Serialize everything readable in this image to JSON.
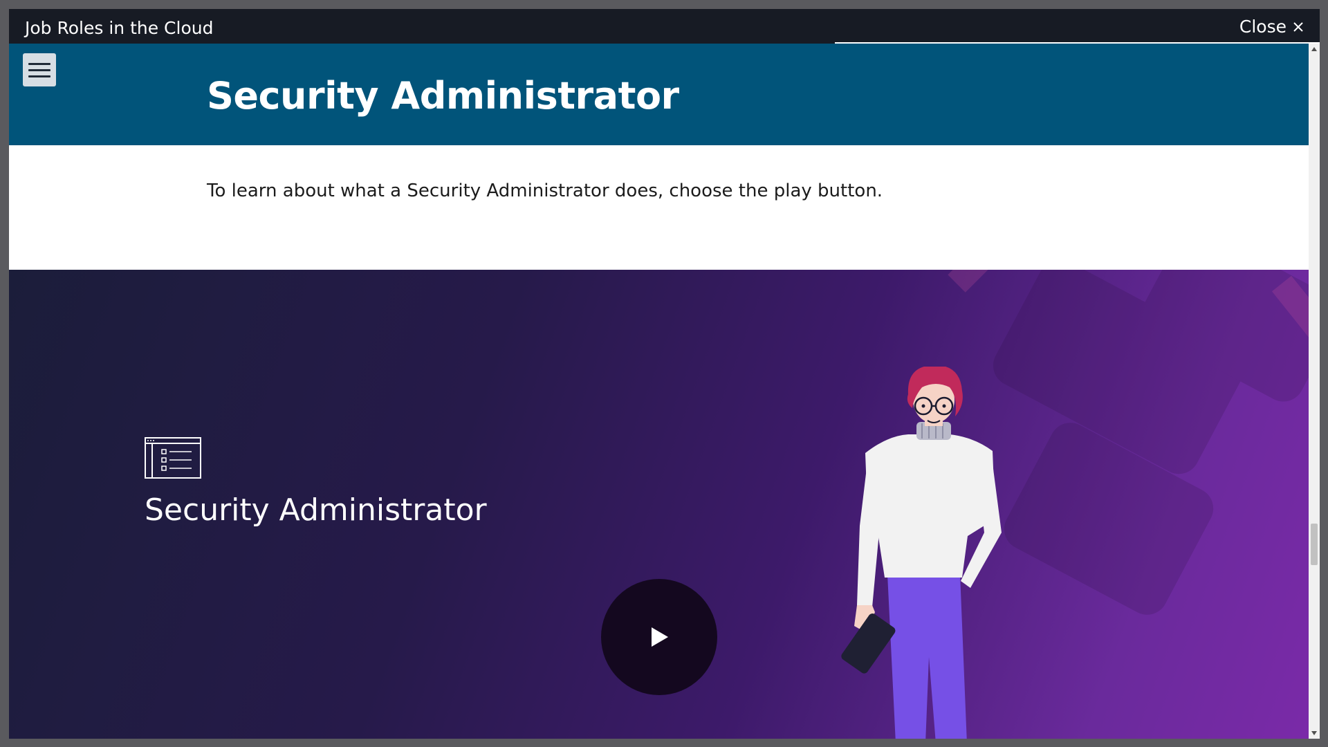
{
  "window": {
    "title": "Job Roles in the Cloud",
    "close_label": "Close"
  },
  "header": {
    "title": "Security Administrator"
  },
  "main": {
    "instructions": "To learn about what a Security Administrator does, choose the play button."
  },
  "video": {
    "title": "Security Administrator",
    "role_icon": "document-list-icon"
  },
  "colors": {
    "titlebar": "#171b24",
    "header_band": "#01547a",
    "play_button": "#14081f"
  }
}
